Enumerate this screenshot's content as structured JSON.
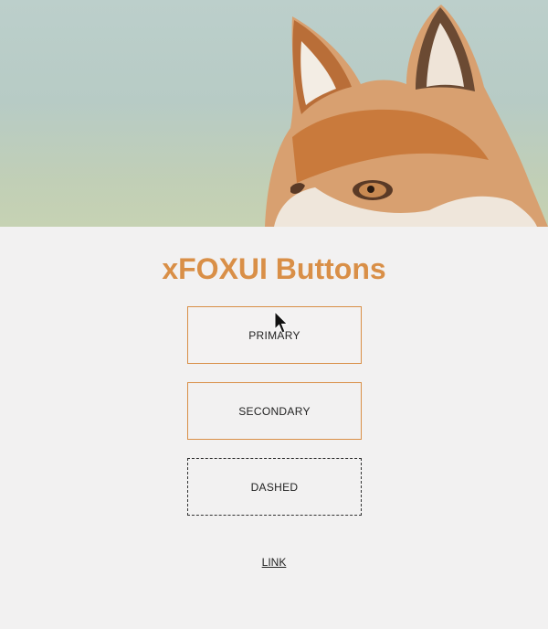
{
  "hero": {
    "icon": "fox-photo",
    "sky_color": "#bccfcb",
    "fox_color": "#d4894a"
  },
  "page": {
    "title": "xFOXUI Buttons",
    "accent_color": "#d98f47"
  },
  "buttons": {
    "primary_label": "PRIMARY",
    "secondary_label": "SECONDARY",
    "dashed_label": "DASHED",
    "link_label": "LINK"
  },
  "cursor": {
    "icon": "mouse-pointer-icon"
  }
}
